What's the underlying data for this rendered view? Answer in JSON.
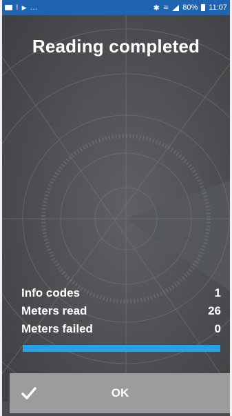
{
  "status_bar": {
    "battery": "80%",
    "time": "11:07",
    "icons": [
      "image-icon",
      "warning-icon",
      "play-icon",
      "more-icon",
      "bluetooth-icon",
      "wifi-icon",
      "signal-icon",
      "battery-icon"
    ]
  },
  "screen": {
    "title": "Reading completed"
  },
  "stats": [
    {
      "label": "Info codes",
      "value": "1"
    },
    {
      "label": "Meters read",
      "value": "26"
    },
    {
      "label": "Meters failed",
      "value": "0"
    }
  ],
  "progress": {
    "fraction": 1.0,
    "color": "#29a0e6"
  },
  "ok_button": {
    "label": "OK",
    "icon": "check-icon"
  },
  "colors": {
    "status_bar": "#1e64b0",
    "background": "#4a4c4f",
    "ok_bar": "#9c9c9c"
  }
}
